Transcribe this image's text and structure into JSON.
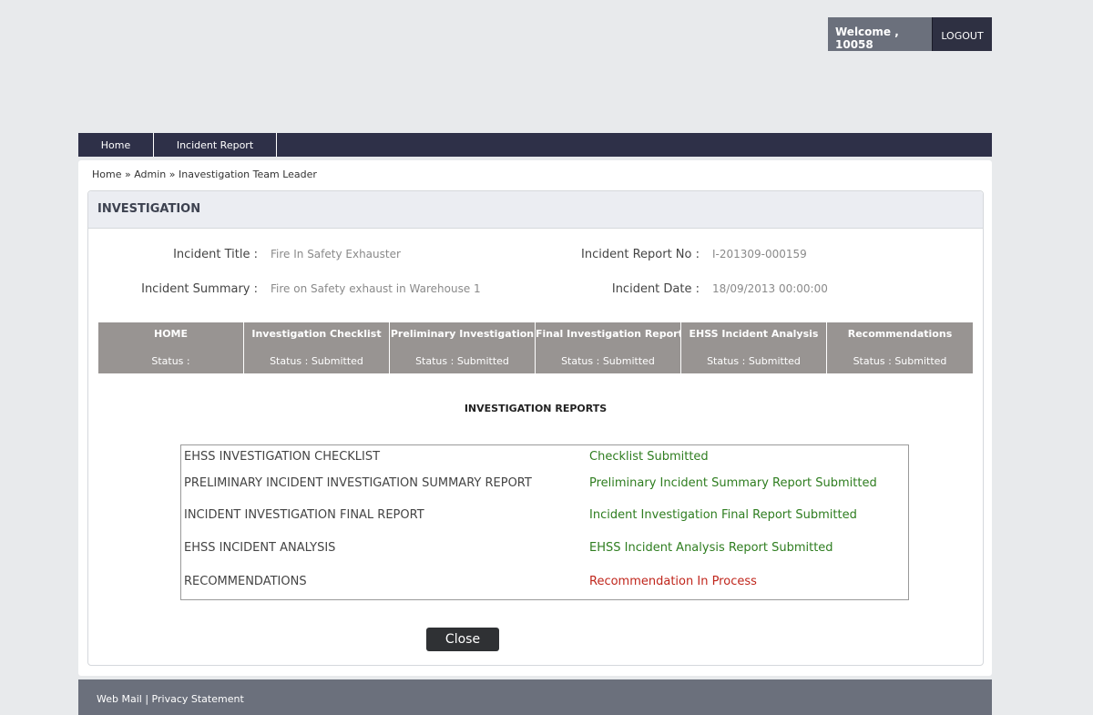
{
  "header": {
    "welcome": "Welcome , 10058",
    "logout": "LOGOUT"
  },
  "nav": {
    "home": "Home",
    "incident_report": "Incident Report"
  },
  "breadcrumb": {
    "home": "Home",
    "sep": "»",
    "admin": "Admin",
    "current": "Inavestigation Team Leader"
  },
  "panel": {
    "title": "INVESTIGATION"
  },
  "incident": {
    "title_label": "Incident Title :",
    "title_value": "Fire In Safety Exhauster",
    "summary_label": "Incident Summary :",
    "summary_value": "Fire on Safety exhaust in Warehouse 1",
    "report_no_label": "Incident Report No :",
    "report_no_value": "I-201309-000159",
    "date_label": "Incident Date :",
    "date_value": "18/09/2013 00:00:00"
  },
  "status_steps": [
    {
      "title": "HOME",
      "status": "Status :"
    },
    {
      "title": "Investigation Checklist",
      "status": "Status : Submitted"
    },
    {
      "title": "Preliminary Investigation",
      "status": "Status : Submitted"
    },
    {
      "title": "Final Investigation Report",
      "status": "Status : Submitted"
    },
    {
      "title": "EHSS Incident Analysis",
      "status": "Status : Submitted"
    },
    {
      "title": "Recommendations",
      "status": "Status : Submitted"
    }
  ],
  "reports": {
    "title": "INVESTIGATION REPORTS",
    "rows": [
      {
        "name": "EHSS INVESTIGATION CHECKLIST",
        "status": "Checklist Submitted",
        "color": "#2e7d1f"
      },
      {
        "name": "PRELIMINARY INCIDENT INVESTIGATION SUMMARY REPORT",
        "status": "Preliminary Incident Summary Report Submitted",
        "color": "#2e7d1f"
      },
      {
        "name": "INCIDENT INVESTIGATION FINAL REPORT",
        "status": "Incident Investigation Final Report Submitted",
        "color": "#2e7d1f"
      },
      {
        "name": "EHSS INCIDENT ANALYSIS",
        "status": "EHSS Incident Analysis Report Submitted",
        "color": "#2e7d1f"
      },
      {
        "name": "RECOMMENDATIONS",
        "status": "Recommendation In Process",
        "color": "#c0261c"
      }
    ]
  },
  "actions": {
    "close": "Close"
  },
  "footer": {
    "webmail": "Web Mail",
    "sep": "|",
    "privacy": "Privacy Statement"
  }
}
